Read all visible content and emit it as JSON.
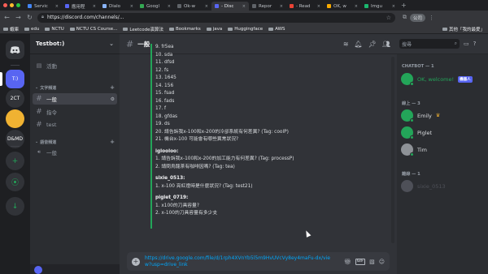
{
  "browser": {
    "tabs": [
      {
        "label": "Servic",
        "color": "#4285f4",
        "active": false
      },
      {
        "label": "應用程",
        "color": "#5865f2",
        "active": false
      },
      {
        "label": "Dialo",
        "color": "#8ab4f8",
        "active": false
      },
      {
        "label": "Googl",
        "color": "#34a853",
        "active": false
      },
      {
        "label": "Ok-w",
        "color": "#5f6368",
        "active": false
      },
      {
        "label": "- Disc",
        "color": "#5865f2",
        "active": true
      },
      {
        "label": "Repor",
        "color": "#5f6368",
        "active": false
      },
      {
        "label": "- Read",
        "color": "#ea4335",
        "active": false
      },
      {
        "label": "OK, w",
        "color": "#f9ab00",
        "active": false
      },
      {
        "label": "Imgu",
        "color": "#1bb76e",
        "active": false
      }
    ],
    "url": "https://discord.com/channels/...",
    "profile_label": "公司",
    "bookmarks": [
      "蝦庫",
      "edu",
      "NCTU",
      "NCTU CS Course...",
      "Leetcode演算法",
      "Bookmarks",
      "java",
      "Huggingface",
      "AWS"
    ],
    "bookmarks_right": "其他「我的最愛」"
  },
  "servers": [
    {
      "label": "T:)",
      "color": "#5865f2",
      "active": true
    },
    {
      "label": "2CT",
      "color": "#313338",
      "active": false
    },
    {
      "label": "",
      "color": "#f0b232",
      "active": false
    },
    {
      "label": "D&MD",
      "color": "#313338",
      "active": false
    },
    {
      "label": "+",
      "color": "#313338",
      "active": false
    },
    {
      "label": "⦿",
      "color": "#313338",
      "active": false
    },
    {
      "label": "↓",
      "color": "#313338",
      "active": false
    }
  ],
  "guild": {
    "name": "Testbot:)",
    "activity_label": "活動",
    "text_category": "文字頻道",
    "voice_category": "語音頻道",
    "text_channels": [
      "一般",
      "指令",
      "test"
    ],
    "voice_channels": [
      "一般"
    ]
  },
  "chat": {
    "channel_name": "一般",
    "lines": [
      {
        "kind": "text",
        "text": "9. fr5ea"
      },
      {
        "kind": "text",
        "text": "10. sda"
      },
      {
        "kind": "text",
        "text": "11. dfsd"
      },
      {
        "kind": "text",
        "text": "12. fs"
      },
      {
        "kind": "text",
        "text": "13. 1645"
      },
      {
        "kind": "text",
        "text": "14. 156"
      },
      {
        "kind": "text",
        "text": "15. fsad"
      },
      {
        "kind": "text",
        "text": "16. fads"
      },
      {
        "kind": "text",
        "text": "17. f"
      },
      {
        "kind": "text",
        "text": "18. gfdas"
      },
      {
        "kind": "text",
        "text": "19. ds"
      },
      {
        "kind": "text",
        "text": "20. 請告訴我x-100和x-200的冷卻系統有何差異? (Tag: coolP)"
      },
      {
        "kind": "text",
        "text": "21. 機台x-100 可能會有哪些異常狀況?"
      },
      {
        "kind": "gap",
        "text": ""
      },
      {
        "kind": "user",
        "text": "iglooloo:"
      },
      {
        "kind": "text",
        "text": "1. 請告訴我x-100和x-200的加工能力有何差異? (Tag: processP)"
      },
      {
        "kind": "text",
        "text": "2. 請問烏龍茶有咖啡因嗎? (Tag: tea)"
      },
      {
        "kind": "gap",
        "text": ""
      },
      {
        "kind": "user",
        "text": "sixie_0513:"
      },
      {
        "kind": "text",
        "text": "1. x-100 亮紅燈時是什麼狀況? (Tag: test21)"
      },
      {
        "kind": "gap",
        "text": ""
      },
      {
        "kind": "user",
        "text": "piglet_0719:"
      },
      {
        "kind": "text",
        "text": "1. x100的刀具容量?"
      },
      {
        "kind": "text",
        "text": "2. x-100的刀具容量有多少支"
      }
    ],
    "composer_text": "https://drive.google.com/file/d/1rph4XVnYb5l5m9HvUVcVy8ey4maFu-dx/view?usp=drive_link"
  },
  "members": {
    "search_placeholder": "搜尋",
    "groups": [
      {
        "title": "CHATBOT — 1",
        "members": [
          {
            "name": "OK, welcome!",
            "badge": "機器人",
            "color": "#23a559",
            "dim": false
          }
        ]
      },
      {
        "title": "線上 — 3",
        "members": [
          {
            "name": "Emily",
            "crown": "♛",
            "color": "#23a559",
            "dim": false
          },
          {
            "name": "Piglet",
            "color": "#23a559",
            "dim": false
          },
          {
            "name": "Tim",
            "color": "#8e9297",
            "dim": false
          }
        ]
      },
      {
        "title": "離線 — 1",
        "members": [
          {
            "name": "sixie_0513",
            "color": "#4e5058",
            "dim": true
          }
        ]
      }
    ]
  }
}
